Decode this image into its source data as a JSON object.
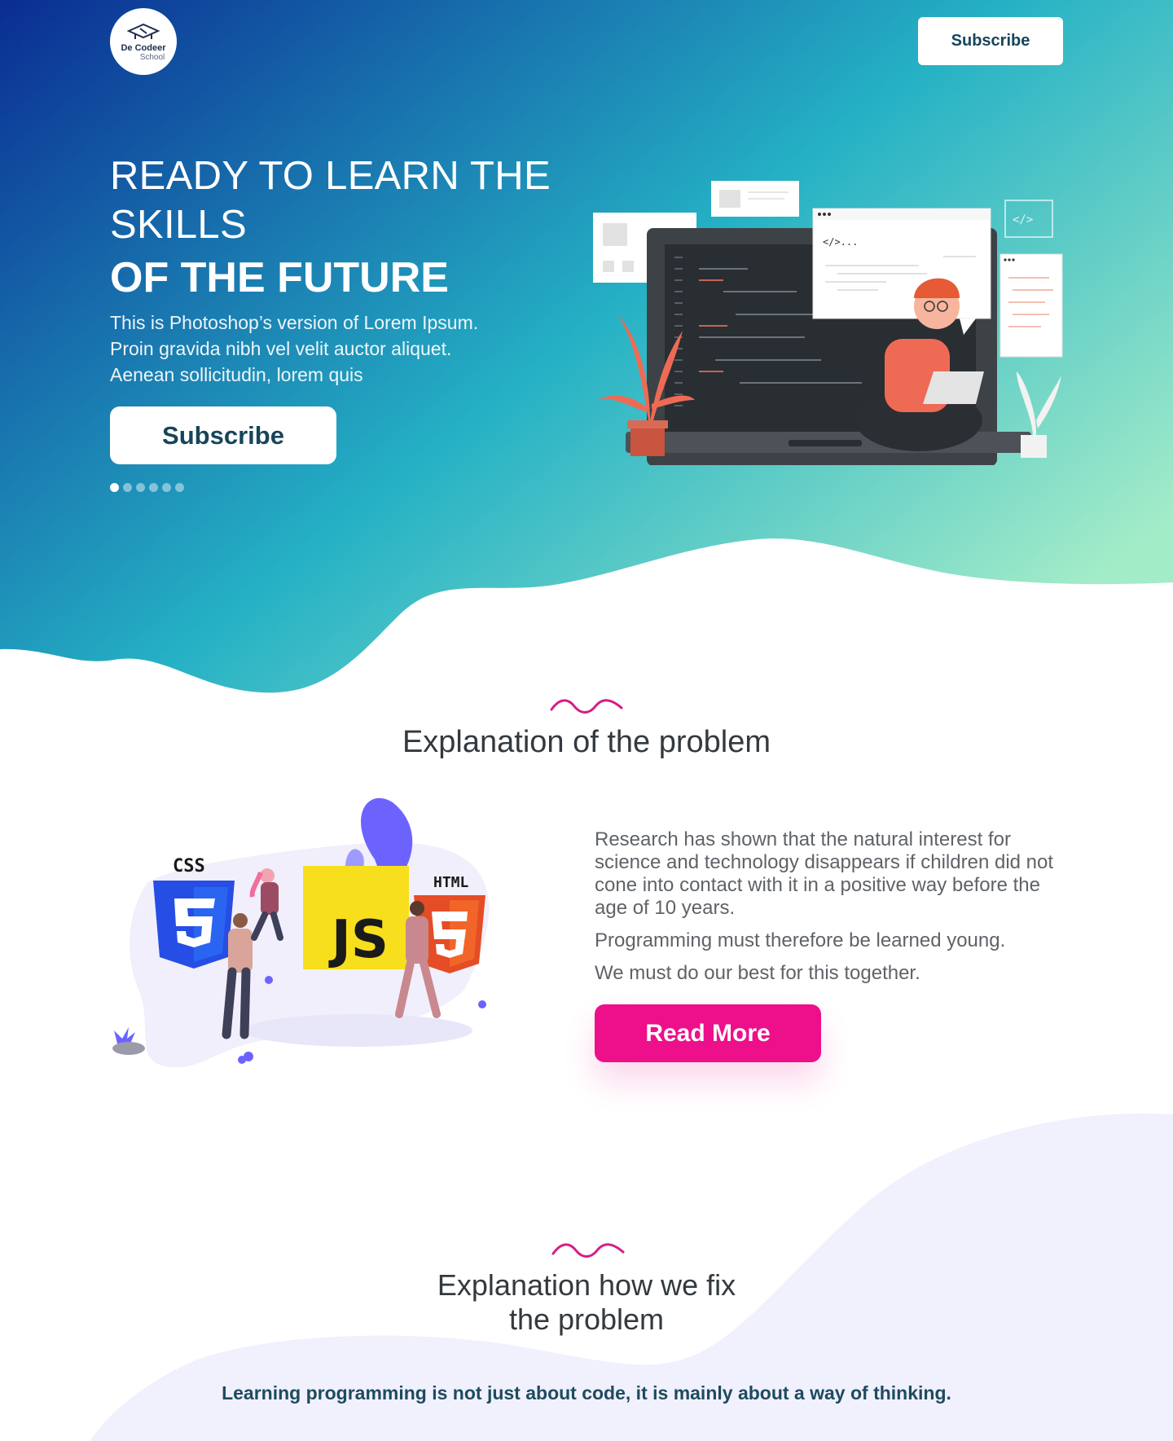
{
  "colors": {
    "hero_gradient_start": "#0a2d93",
    "hero_gradient_mid": "#25b1c5",
    "hero_gradient_end": "#a3ecc8",
    "accent_pink": "#ee0f8a",
    "button_text": "#17455a",
    "section3_bg": "#f1f0fd"
  },
  "header": {
    "logo": {
      "line1": "De Codeer",
      "line2": "School",
      "icon": "graduation-cap-icon"
    },
    "subscribe_label": "Subscribe"
  },
  "hero": {
    "title_line1": "READY TO LEARN THE",
    "title_line2": "SKILLS",
    "title_bold": "OF THE FUTURE",
    "desc_line1": "This is Photoshop’s version of Lorem Ipsum.",
    "desc_line2": "Proin gravida nibh vel velit auctor aliquet.",
    "desc_line3": "Aenean sollicitudin, lorem quis",
    "cta_label": "Subscribe",
    "carousel": {
      "total": 6,
      "active": 1
    },
    "illustration": {
      "code_window_label": "</>...",
      "code_icon": "</>"
    }
  },
  "problem": {
    "title": "Explanation of the problem",
    "paragraph1": "Research has shown that the natural interest for science and technology disappears if children did not cone into contact with it in a positive way before the age of 10 years.",
    "paragraph2": "Programming must therefore be learned young.",
    "paragraph3": "We must do our best for this together.",
    "cta_label": "Read More",
    "illustration": {
      "css_label": "CSS",
      "html_label": "HTML",
      "js_label": "JS"
    }
  },
  "solution": {
    "title_line1": "Explanation how we fix",
    "title_line2": "the problem",
    "subtitle": "Learning programming is not just about code, it is mainly about a way of thinking."
  }
}
